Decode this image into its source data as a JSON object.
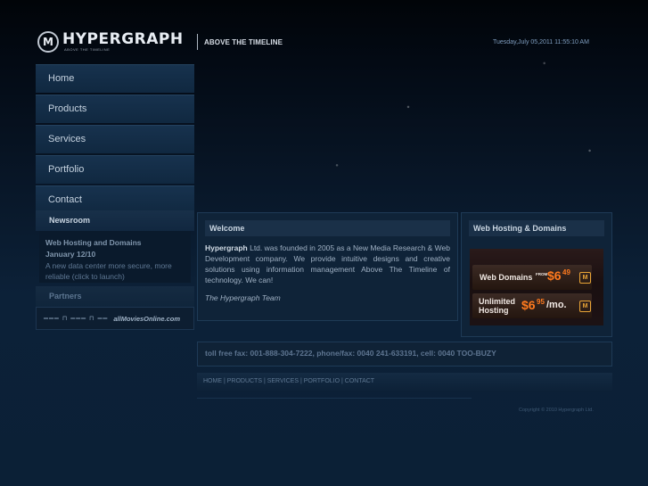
{
  "header": {
    "logo_text": "HYPERGRAPH",
    "logo_sub": "ABOVE THE TIMELINE",
    "tagline": "ABOVE THE TIMELINE",
    "datetime": "Tuesday,July 05,2011 11:55:10 AM"
  },
  "nav": [
    "Home",
    "Products",
    "Services",
    "Portfolio",
    "Contact"
  ],
  "newsroom": {
    "heading": "Newsroom",
    "title": "Web Hosting and Domains",
    "date": "January 12/10",
    "text": "A new data center more secure, more reliable (click to launch)"
  },
  "partners": {
    "heading": "Partners",
    "logo1": "═══ ⊓ ═══ ⊓ ══",
    "logo2": "allMoviesOnline.com"
  },
  "welcome": {
    "heading": "Welcome",
    "company": "Hypergraph",
    "body": " Ltd. was founded in 2005 as a New Media Research & Web Development company. We provide intuitive designs and creative solutions using information management Above The Timeline of technology. We can!",
    "signature": "The Hypergraph Team"
  },
  "hosting": {
    "heading": "Web Hosting & Domains",
    "domains_label": "Web Domains",
    "domains_from": "FROM",
    "domains_price": "$6",
    "domains_cents": "49",
    "hosting_label1": "Unlimited",
    "hosting_label2": "Hosting",
    "hosting_price": "$6",
    "hosting_cents": "95",
    "hosting_per": "/mo."
  },
  "contact": {
    "text": "toll free fax: 001-888-304-7222, phone/fax: 0040 241-633191, cell: 0040 TOO-BUZY"
  },
  "footer": {
    "links": [
      "HOME",
      "PRODUCTS",
      "SERVICES",
      "PORTFOLIO",
      "CONTACT"
    ],
    "copyright": "Copyright © 2010 Hypergraph Ltd."
  },
  "colors": {
    "background": "#0b2036",
    "accent_orange": "#ff7a1e",
    "datetime_blue": "#7f9ec0"
  }
}
